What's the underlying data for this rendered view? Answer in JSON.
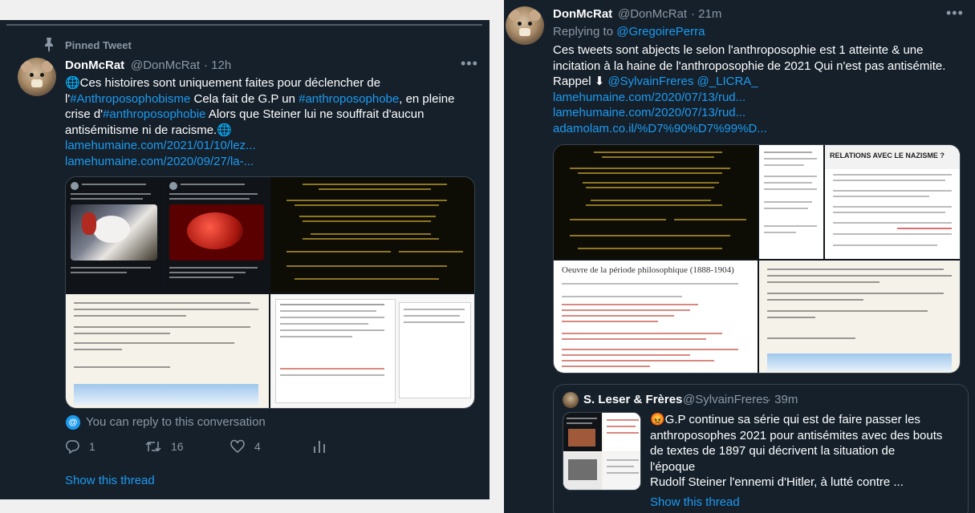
{
  "left_tweet": {
    "pinned_label": "Pinned Tweet",
    "name": "DonMcRat",
    "handle": "@DonMcRat",
    "time": "· 12h",
    "line1": "🌐Ces histoires sont uniquement faites pour déclencher de",
    "l2_a": "l'",
    "l2_tag1": "#Anthroposophobisme",
    "l2_b": " Cela fait de G.P un ",
    "l2_tag2": "#anthroposophobe",
    "l2_c": ", en pleine",
    "l3_a": "crise d'",
    "l3_tag": "#anthroposophobie",
    "l3_b": " Alors que Steiner lui ne souffrait d'aucun",
    "line4": "antisémitisme ni de racisme.🌐",
    "link1": "lamehumaine.com/2021/01/10/lez...",
    "link2": "lamehumaine.com/2020/09/27/la-...",
    "reply_notice": "You can reply to this conversation",
    "replies": "1",
    "retweets": "16",
    "likes": "4",
    "show_thread": "Show this thread"
  },
  "right_tweet": {
    "name": "DonMcRat",
    "handle": "@DonMcRat",
    "time": "· 21m",
    "replying_prefix": "Replying to ",
    "replying_to": "@GregoirePerra",
    "line1": "Ces tweets sont abjects le selon l'anthroposophie est 1 atteinte & une",
    "line2": "incitation à la haine de l'anthroposophie de 2021 Qui n'est pas antisémite.",
    "line3_a": "Rappel ⬇ ",
    "line3_m1": "@SylvainFreres",
    "line3_m2": "@_LICRA_",
    "link1": "lamehumaine.com/2020/07/13/rud...",
    "link2": "lamehumaine.com/2020/07/13/rud...",
    "link3": "adamolam.co.il/%D7%90%D7%99%D...",
    "media": {
      "relations_title": "RELATIONS AVEC LE NAZISME ?",
      "oeuvre_title": "Oeuvre de la période philosophique (1888-1904)"
    },
    "quote": {
      "name": "S. Leser & Frères",
      "handle": "@SylvainFreres",
      "time": "· 39m",
      "line1": "😡G.P continue sa série qui est de faire passer les",
      "line2": "anthroposophes 2021 pour antisémites avec des bouts",
      "line3": "de textes de 1897 qui décrivent la situation de",
      "line4": "l'époque",
      "line5": "Rudolf Steiner l'ennemi d'Hitler, à lutté contre ..."
    },
    "show_thread": "Show this thread"
  },
  "colors": {
    "background": "#15202b",
    "text": "#ffffff",
    "secondary": "#8b98a5",
    "accent": "#1d9bf0",
    "border": "#38444d"
  }
}
